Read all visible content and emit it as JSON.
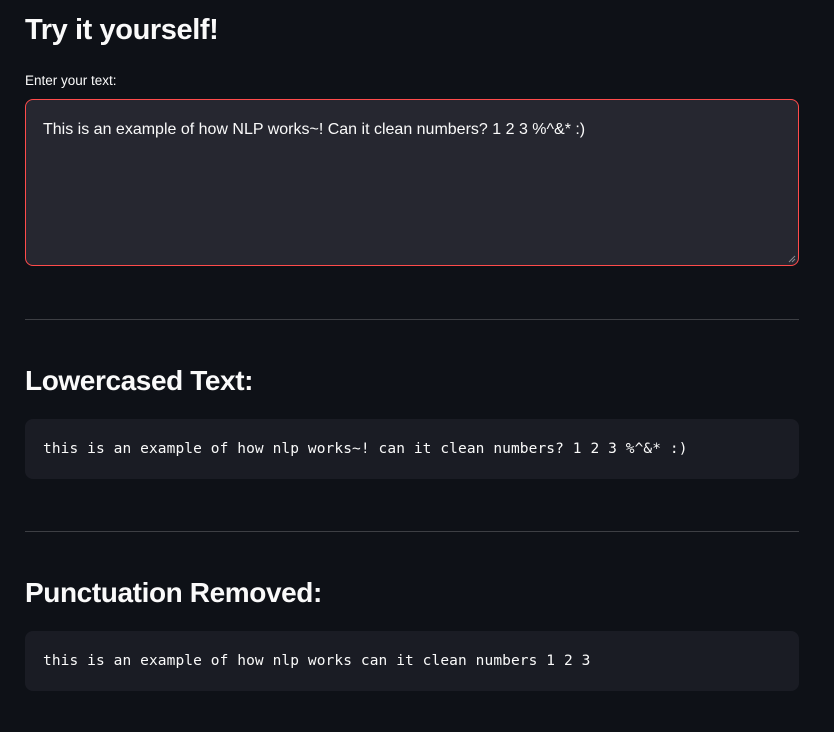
{
  "section_try": {
    "heading": "Try it yourself!",
    "input_label": "Enter your text:",
    "input_value": "This is an example of how NLP works~! Can it clean numbers? 1 2 3 %^&* :)"
  },
  "section_lowercased": {
    "heading": "Lowercased Text:",
    "output": "this is an example of how nlp works~! can it clean numbers? 1 2 3 %^&* :)"
  },
  "section_punctuation": {
    "heading": "Punctuation Removed:",
    "output": "this is an example of how nlp works can it clean numbers 1 2 3"
  },
  "colors": {
    "background": "#0e1117",
    "input_background": "#262730",
    "input_focus_border": "#ff4b4b",
    "code_background": "#1a1c24",
    "text": "#fafafa"
  }
}
